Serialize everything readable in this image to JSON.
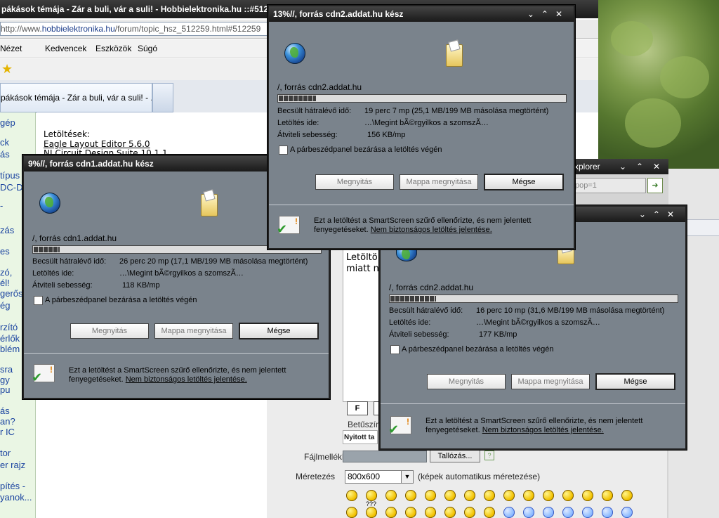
{
  "browser": {
    "title": "pákások témája - Zár a buli, vár a suli! - Hobbielektronika.hu ::#512",
    "address_prefix": "http://www.",
    "address_domain": "hobbielektronika.hu",
    "address_rest": "/forum/topic_hsz_512259.html#512259",
    "menu": [
      "Nézet",
      "Kedvencek",
      "Eszközök",
      "Súgó"
    ],
    "tab_title": "pákások témája - Zár a buli, vár a suli! - ...",
    "sidebar_fragments": [
      "gép",
      "ck",
      "ás",
      "típus",
      "DC-D",
      "-",
      "zás",
      "es",
      "zó,",
      "él!",
      "gerősí",
      "ég",
      "rzító",
      "érlők",
      "blém",
      "sra",
      "gy",
      "pu",
      "ás",
      "an?",
      "r IC",
      "tor",
      "er rajz",
      "pítés -",
      "yanok..."
    ],
    "downloads_label": "Letöltések:",
    "download_link1": "Eagle Layout Editor 5.6.0",
    "download_link2": "NI Circuit Design Suite 10.1.1"
  },
  "browser2": {
    "title_fragment": "xplorer",
    "address_fragment": "pop=1"
  },
  "form": {
    "post_fragment1": "Letöltö",
    "post_fragment2": "miatt n",
    "bold_btn": "F",
    "font_label": "Betűszín",
    "opened_label": "Nyitott ta",
    "attach_label": "Fájlmelléklet",
    "browse_label": "Tallózás...",
    "help_label": "?",
    "resize_label": "Méretezés",
    "resize_value": "800x600",
    "resize_hint": "(képek automatikus méretezése)",
    "smiley_text": "???"
  },
  "dialogs": [
    {
      "title": "13%//, forrás cdn2.addat.hu kész",
      "source": "/, forrás cdn2.addat.hu",
      "progress": 0.13,
      "eta_label": "Becsült hátralévő idő:",
      "eta_value": "19 perc 7 mp (25,1 MB/199 MB másolása megtörtént)",
      "dest_label": "Letöltés ide:",
      "dest_value": "…\\Megint bÃ©rgyilkos a szomszÃ…",
      "speed_label": "Átviteli sebesség:",
      "speed_value": "156 KB/mp",
      "close_label": "A párbeszédpanel bezárása a letöltés végén",
      "open_btn": "Megnyitás",
      "folder_btn": "Mappa megnyitása",
      "cancel_btn": "Mégse",
      "note1": "Ezt a letöltést a SmartScreen szűrő ellenőrizte, és nem jelentett",
      "note2": "fenyegetéseket.",
      "note_link": "Nem biztonságos letöltés jelentése."
    },
    {
      "title": "9%//, forrás cdn1.addat.hu kész",
      "source": "/, forrás cdn1.addat.hu",
      "progress": 0.09,
      "eta_label": "Becsült hátralévő idő:",
      "eta_value": "26 perc 20 mp (17,1 MB/199 MB másolása megtörtént)",
      "dest_label": "Letöltés ide:",
      "dest_value": "…\\Megint bÃ©rgyilkos a szomszÃ…",
      "speed_label": "Átviteli sebesség:",
      "speed_value": "118 KB/mp",
      "close_label": "A párbeszédpanel bezárása a letöltés végén",
      "open_btn": "Megnyitás",
      "folder_btn": "Mappa megnyitása",
      "cancel_btn": "Mégse",
      "note1": "Ezt a letöltést a SmartScreen szűrő ellenőrizte, és nem jelentett",
      "note2": "fenyegetéseket.",
      "note_link": "Nem biztonságos letöltés jelentése."
    },
    {
      "title": "",
      "source": "/, forrás cdn2.addat.hu",
      "progress": 0.16,
      "eta_label": "Becsült hátralévő idő:",
      "eta_value": "16 perc 10 mp (31,6 MB/199 MB másolása megtörtént)",
      "dest_label": "Letöltés ide:",
      "dest_value": "…\\Megint bÃ©rgyilkos a szomszÃ…",
      "speed_label": "Átviteli sebesség:",
      "speed_value": "177 KB/mp",
      "close_label": "A párbeszédpanel bezárása a letöltés végén",
      "open_btn": "Megnyitás",
      "folder_btn": "Mappa megnyitása",
      "cancel_btn": "Mégse",
      "note1": "Ezt a letöltést a SmartScreen szűrő ellenőrizte, és nem jelentett",
      "note2": "fenyegetéseket.",
      "note_link": "Nem biztonságos letöltés jelentése."
    }
  ],
  "controls": {
    "minimize": "⌄",
    "restore": "⌃",
    "close": "✕"
  }
}
